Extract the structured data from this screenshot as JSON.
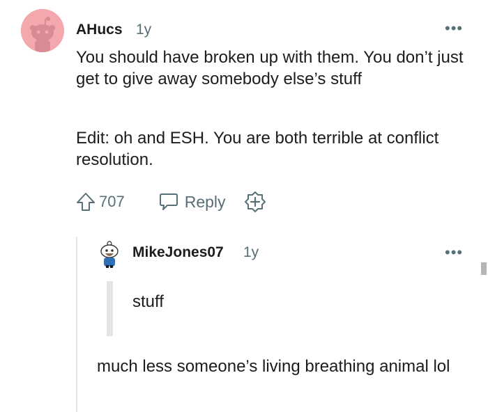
{
  "comment": {
    "username": "AHucs",
    "time": "1y",
    "more_icon": "ellipsis-icon",
    "paragraphs": [
      "You should have broken up with them. You don’t just get to give away somebody else’s stuff",
      "Edit: oh and ESH. You are both terrible at conflict resolution."
    ],
    "upvotes": "707",
    "reply_label": "Reply",
    "avatar_color": "#f4a7ad"
  },
  "reply": {
    "username": "MikeJones07",
    "time": "1y",
    "quote": "stuff",
    "text": "much less someone’s living breathing animal lol"
  },
  "colors": {
    "text": "#1c1c1c",
    "meta": "#576f76",
    "thread_line": "#e2e5e7"
  }
}
